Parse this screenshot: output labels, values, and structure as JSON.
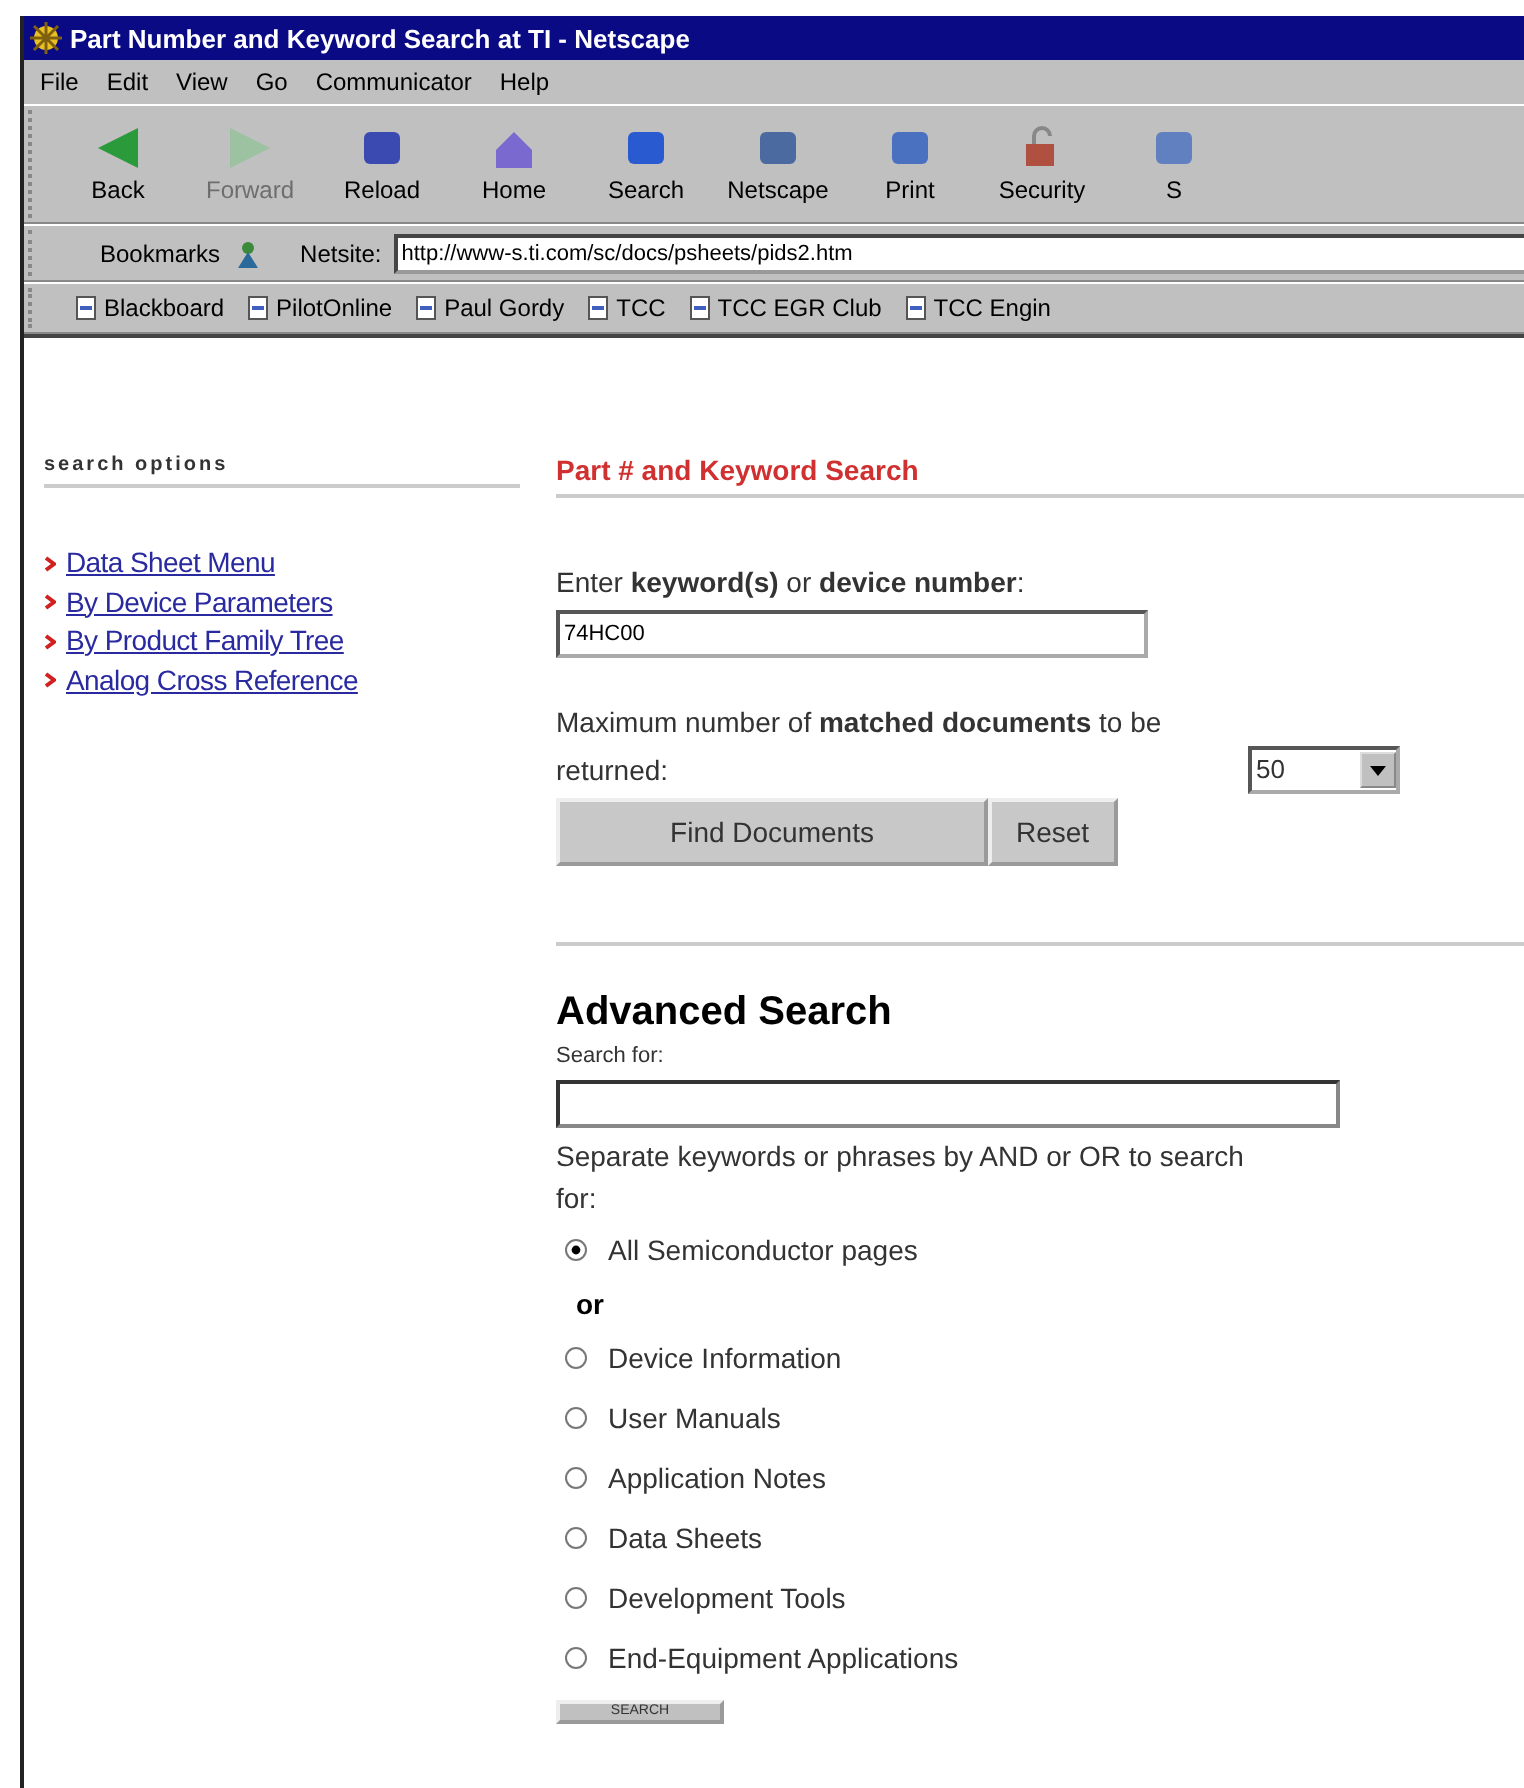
{
  "window": {
    "title": "Part Number and Keyword Search at TI - Netscape"
  },
  "menu": [
    "File",
    "Edit",
    "View",
    "Go",
    "Communicator",
    "Help"
  ],
  "toolbar": [
    {
      "label": "Back",
      "disabled": false,
      "kind": "back"
    },
    {
      "label": "Forward",
      "disabled": true,
      "kind": "forward"
    },
    {
      "label": "Reload",
      "disabled": false,
      "kind": "reload"
    },
    {
      "label": "Home",
      "disabled": false,
      "kind": "home"
    },
    {
      "label": "Search",
      "disabled": false,
      "kind": "search"
    },
    {
      "label": "Netscape",
      "disabled": false,
      "kind": "netscape"
    },
    {
      "label": "Print",
      "disabled": false,
      "kind": "print"
    },
    {
      "label": "Security",
      "disabled": false,
      "kind": "security"
    },
    {
      "label": "S",
      "disabled": false,
      "kind": "shop"
    }
  ],
  "location": {
    "bookmarks": "Bookmarks",
    "label": "Netsite:",
    "url": "http://www-s.ti.com/sc/docs/psheets/pids2.htm"
  },
  "personal_bar": [
    "Blackboard",
    "PilotOnline",
    "Paul Gordy",
    "TCC",
    "TCC EGR Club",
    "TCC Engin"
  ],
  "sidebar": {
    "title": "search options",
    "links": [
      "Data Sheet Menu",
      "By Device Parameters",
      "By Product Family Tree",
      "Analog Cross Reference"
    ]
  },
  "part_search": {
    "title": "Part # and Keyword Search",
    "prompt": "Enter **keyword(s)** or **device number**:",
    "value": "74HC00",
    "max_text": "Maximum number of **matched documents** to be returned:",
    "max_value": "50",
    "buttons": [
      "Find Documents",
      "Reset"
    ]
  },
  "advanced": {
    "title": "Advanced Search",
    "search_label": "Search for:",
    "hint": "Separate keywords or phrases by AND or OR to search for:",
    "options": [
      {
        "kind": "radio",
        "label": "All Semiconductor pages",
        "selected": true
      },
      {
        "kind": "separator",
        "label": "or"
      },
      {
        "kind": "radio",
        "label": "Device Information",
        "selected": false
      },
      {
        "kind": "radio",
        "label": "User Manuals",
        "selected": false
      },
      {
        "kind": "radio",
        "label": "Application Notes",
        "selected": false
      },
      {
        "kind": "radio",
        "label": "Data Sheets",
        "selected": false
      },
      {
        "kind": "radio",
        "label": "Development Tools",
        "selected": false
      },
      {
        "kind": "radio",
        "label": "End-Equipment Applications",
        "selected": false
      }
    ],
    "button": "SEARCH"
  }
}
